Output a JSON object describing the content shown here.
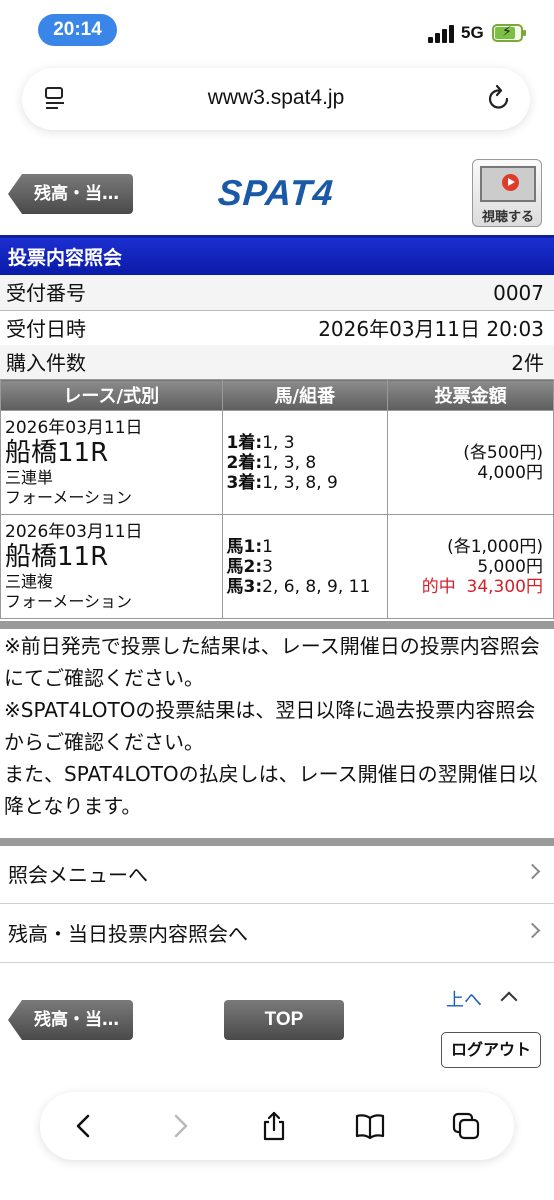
{
  "status": {
    "time": "20:14",
    "network": "5G",
    "battery_level": 0.8
  },
  "browser": {
    "url": "www3.spat4.jp"
  },
  "header": {
    "back_label": "残高・当…",
    "logo": "SPAT4",
    "watch_label": "視聴する"
  },
  "section_title": "投票内容照会",
  "info": [
    {
      "label": "受付番号",
      "value": "0007"
    },
    {
      "label": "受付日時",
      "value": "2026年03月11日 20:03"
    },
    {
      "label": "購入件数",
      "value": "2件"
    }
  ],
  "table": {
    "headers": [
      "レース/式別",
      "馬/組番",
      "投票金額"
    ],
    "rows": [
      {
        "date": "2026年03月11日",
        "venue": "船橋11R",
        "bet_type": "三連単",
        "method": "フォーメーション",
        "combos": [
          {
            "label": "1着:",
            "value": "1, 3"
          },
          {
            "label": "2着:",
            "value": "1, 3, 8"
          },
          {
            "label": "3着:",
            "value": "1, 3, 8, 9"
          }
        ],
        "amount_each": "(各500円)",
        "amount_total": "4,000円",
        "hit_label": "",
        "hit_amount": ""
      },
      {
        "date": "2026年03月11日",
        "venue": "船橋11R",
        "bet_type": "三連複",
        "method": "フォーメーション",
        "combos": [
          {
            "label": "馬1:",
            "value": "1"
          },
          {
            "label": "馬2:",
            "value": "3"
          },
          {
            "label": "馬3:",
            "value": "2, 6, 8, 9, 11"
          }
        ],
        "amount_each": "(各1,000円)",
        "amount_total": "5,000円",
        "hit_label": "的中",
        "hit_amount": "34,300円"
      }
    ]
  },
  "notes": [
    "※前日発売で投票した結果は、レース開催日の投票内容照会にてご確認ください。",
    "※SPAT4LOTOの投票結果は、翌日以降に過去投票内容照会からご確認ください。",
    "また、SPAT4LOTOの払戻しは、レース開催日の翌開催日以降となります。"
  ],
  "menu": [
    {
      "label": "照会メニューへ"
    },
    {
      "label": "残高・当日投票内容照会へ"
    }
  ],
  "footer": {
    "back_label": "残高・当…",
    "top_label": "TOP",
    "up_label": "上へ",
    "logout_label": "ログアウト"
  },
  "colors": {
    "accent": "#0a1aa8",
    "hit": "#d4202a",
    "logo": "#1a58a8"
  }
}
